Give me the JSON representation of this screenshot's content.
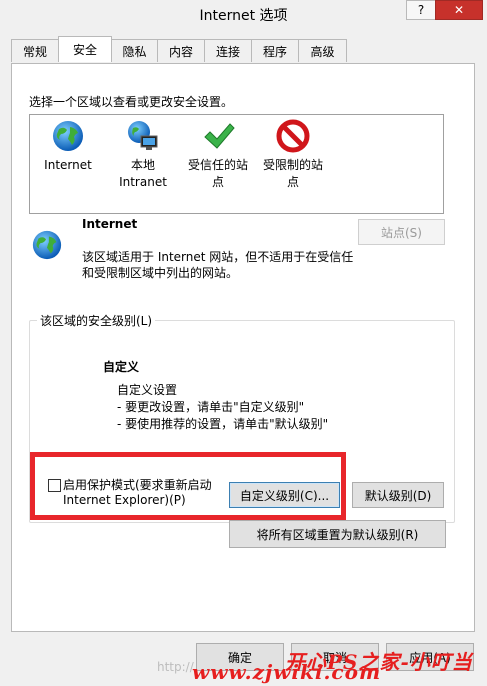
{
  "window": {
    "title": "Internet 选项",
    "help_glyph": "?",
    "close_glyph": "✕"
  },
  "tabs": [
    {
      "label": "常规"
    },
    {
      "label": "安全"
    },
    {
      "label": "隐私"
    },
    {
      "label": "内容"
    },
    {
      "label": "连接"
    },
    {
      "label": "程序"
    },
    {
      "label": "高级"
    }
  ],
  "security": {
    "zone_prompt": "选择一个区域以查看或更改安全设置。",
    "zones": [
      {
        "label_line1": "Internet",
        "label_line2": "",
        "icon": "globe-icon"
      },
      {
        "label_line1": "本地",
        "label_line2": "Intranet",
        "icon": "intranet-icon"
      },
      {
        "label_line1": "受信任的站",
        "label_line2": "点",
        "icon": "check-icon"
      },
      {
        "label_line1": "受限制的站",
        "label_line2": "点",
        "icon": "restricted-icon"
      }
    ],
    "selected_zone_title": "Internet",
    "selected_zone_desc_line1": "该区域适用于 Internet 网站，但不适用于在受信任",
    "selected_zone_desc_line2": "和受限制区域中列出的网站。",
    "sites_button": "站点(S)",
    "level_group_label": "该区域的安全级别(L)",
    "level_title": "自定义",
    "level_desc_line1": "自定义设置",
    "level_desc_line2": "- 要更改设置，请单击\"自定义级别\"",
    "level_desc_line3": "- 要使用推荐的设置，请单击\"默认级别\"",
    "protected_mode_line1": "启用保护模式(要求重新启动",
    "protected_mode_line2": "Internet Explorer)(P)",
    "custom_level_button": "自定义级别(C)...",
    "default_level_button": "默认级别(D)",
    "reset_all_button": "将所有区域重置为默认级别(R)"
  },
  "footer": {
    "ok": "确定",
    "cancel": "取消",
    "apply": "应用(A)"
  },
  "watermark": {
    "text": "开心PS之家-小叮当",
    "site": "www.zjwiki.com",
    "faint": "http://"
  }
}
